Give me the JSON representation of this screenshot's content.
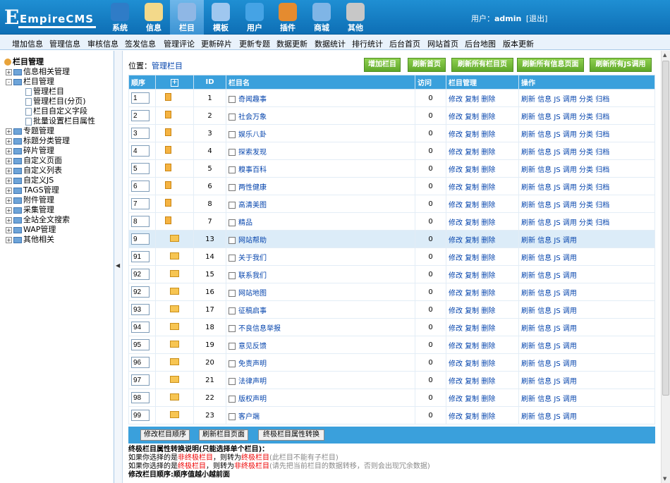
{
  "header": {
    "logo_text": "EmpireCMS",
    "nav": [
      {
        "label": "系统",
        "icon": "globe-icon",
        "color": "#2f7cc7"
      },
      {
        "label": "信息",
        "icon": "document-edit-icon",
        "color": "#f3d98a"
      },
      {
        "label": "栏目",
        "icon": "folder-icon",
        "color": "#8fb7e5",
        "active": true
      },
      {
        "label": "模板",
        "icon": "window-template-icon",
        "color": "#9fc7ef"
      },
      {
        "label": "用户",
        "icon": "user-icon",
        "color": "#45a3e5"
      },
      {
        "label": "插件",
        "icon": "tools-icon",
        "color": "#e58b2f"
      },
      {
        "label": "商城",
        "icon": "card-icon",
        "color": "#7fb5e6"
      },
      {
        "label": "其他",
        "icon": "gear-icon",
        "color": "#c7c7c7"
      }
    ],
    "user_label": "用户：",
    "username": "admin",
    "logout": "[退出]"
  },
  "menubar": [
    "增加信息",
    "管理信息",
    "审核信息",
    "签发信息",
    "管理评论",
    "更新碎片",
    "更新专题",
    "数据更新",
    "数据统计",
    "排行统计",
    "后台首页",
    "网站首页",
    "后台地图",
    "版本更新"
  ],
  "sidebar": {
    "root": "栏目管理",
    "items": [
      {
        "label": "信息相关管理",
        "type": "folder",
        "sign": "+"
      },
      {
        "label": "栏目管理",
        "type": "folder",
        "sign": "-"
      },
      {
        "label": "管理栏目",
        "type": "page"
      },
      {
        "label": "管理栏目(分页)",
        "type": "page"
      },
      {
        "label": "栏目自定义字段",
        "type": "page"
      },
      {
        "label": "批量设置栏目属性",
        "type": "page"
      },
      {
        "label": "专题管理",
        "type": "folder",
        "sign": "+"
      },
      {
        "label": "标题分类管理",
        "type": "folder",
        "sign": "+"
      },
      {
        "label": "碎片管理",
        "type": "folder",
        "sign": "+"
      },
      {
        "label": "自定义页面",
        "type": "folder",
        "sign": "+"
      },
      {
        "label": "自定义列表",
        "type": "folder",
        "sign": "+"
      },
      {
        "label": "自定义JS",
        "type": "folder",
        "sign": "+"
      },
      {
        "label": "TAGS管理",
        "type": "folder",
        "sign": "+"
      },
      {
        "label": "附件管理",
        "type": "folder",
        "sign": "+"
      },
      {
        "label": "采集管理",
        "type": "folder",
        "sign": "+"
      },
      {
        "label": "全站全文搜索",
        "type": "folder",
        "sign": "+"
      },
      {
        "label": "WAP管理",
        "type": "folder",
        "sign": "+"
      },
      {
        "label": "其他相关",
        "type": "folder",
        "sign": "+"
      }
    ]
  },
  "main": {
    "crumb_label": "位置：",
    "crumb_link": "管理栏目",
    "buttons": [
      "增加栏目",
      "刷新首页",
      "刷新所有栏目页",
      "刷新所有信息页面",
      "刷新所有JS调用"
    ],
    "columns": {
      "order": "顺序",
      "expand": "+",
      "id": "ID",
      "name": "栏目名",
      "visits": "访问",
      "manage": "栏目管理",
      "ops": "操作"
    },
    "rows": [
      {
        "order": "1",
        "id": "1",
        "name": "奇闻趣事",
        "visits": "0",
        "kind": "doc"
      },
      {
        "order": "2",
        "id": "2",
        "name": "社会万象",
        "visits": "0",
        "kind": "doc"
      },
      {
        "order": "3",
        "id": "3",
        "name": "娱乐八卦",
        "visits": "0",
        "kind": "doc"
      },
      {
        "order": "4",
        "id": "4",
        "name": "探索发现",
        "visits": "0",
        "kind": "doc"
      },
      {
        "order": "5",
        "id": "5",
        "name": "糗事百科",
        "visits": "0",
        "kind": "doc"
      },
      {
        "order": "6",
        "id": "6",
        "name": "两性健康",
        "visits": "0",
        "kind": "doc"
      },
      {
        "order": "7",
        "id": "8",
        "name": "高清美图",
        "visits": "0",
        "kind": "doc"
      },
      {
        "order": "8",
        "id": "7",
        "name": "精品",
        "visits": "0",
        "kind": "doc"
      },
      {
        "order": "9",
        "id": "13",
        "name": "网站帮助",
        "visits": "0",
        "kind": "folder"
      },
      {
        "order": "91",
        "id": "14",
        "name": "关于我们",
        "visits": "0",
        "kind": "folder"
      },
      {
        "order": "92",
        "id": "15",
        "name": "联系我们",
        "visits": "0",
        "kind": "folder"
      },
      {
        "order": "92",
        "id": "16",
        "name": "网站地图",
        "visits": "0",
        "kind": "folder"
      },
      {
        "order": "93",
        "id": "17",
        "name": "征稿启事",
        "visits": "0",
        "kind": "folder"
      },
      {
        "order": "94",
        "id": "18",
        "name": "不良信息举报",
        "visits": "0",
        "kind": "folder"
      },
      {
        "order": "95",
        "id": "19",
        "name": "意见反馈",
        "visits": "0",
        "kind": "folder"
      },
      {
        "order": "96",
        "id": "20",
        "name": "免责声明",
        "visits": "0",
        "kind": "folder"
      },
      {
        "order": "97",
        "id": "21",
        "name": "法律声明",
        "visits": "0",
        "kind": "folder"
      },
      {
        "order": "98",
        "id": "22",
        "name": "版权声明",
        "visits": "0",
        "kind": "folder"
      },
      {
        "order": "99",
        "id": "23",
        "name": "客户端",
        "visits": "0",
        "kind": "folder"
      }
    ],
    "manage_links": [
      "修改",
      "复制",
      "删除"
    ],
    "ops_doc": [
      "刷新",
      "信息",
      "JS 调用",
      "分类",
      "归档"
    ],
    "ops_folder": [
      "刷新",
      "信息",
      "JS 调用"
    ],
    "footer_buttons": [
      "修改栏目顺序",
      "刷新栏目页面",
      "终极栏目属性转换"
    ],
    "notes": {
      "title": "终极栏目属性转换说明(只能选择单个栏目)：",
      "l1a": "如果你选择的是",
      "l1b": "非终极栏目",
      "l1c": "，则转为",
      "l1d": "终极栏目",
      "l1e": "(此栏目不能有子栏目)",
      "l2a": "如果你选择的是",
      "l2b": "终极栏目",
      "l2c": "，则转为",
      "l2d": "非终极栏目",
      "l2e": "(请先把当前栏目的数据转移，否则会出现冗余数据)",
      "l3": "修改栏目顺序:顺序值越小越前面"
    }
  }
}
